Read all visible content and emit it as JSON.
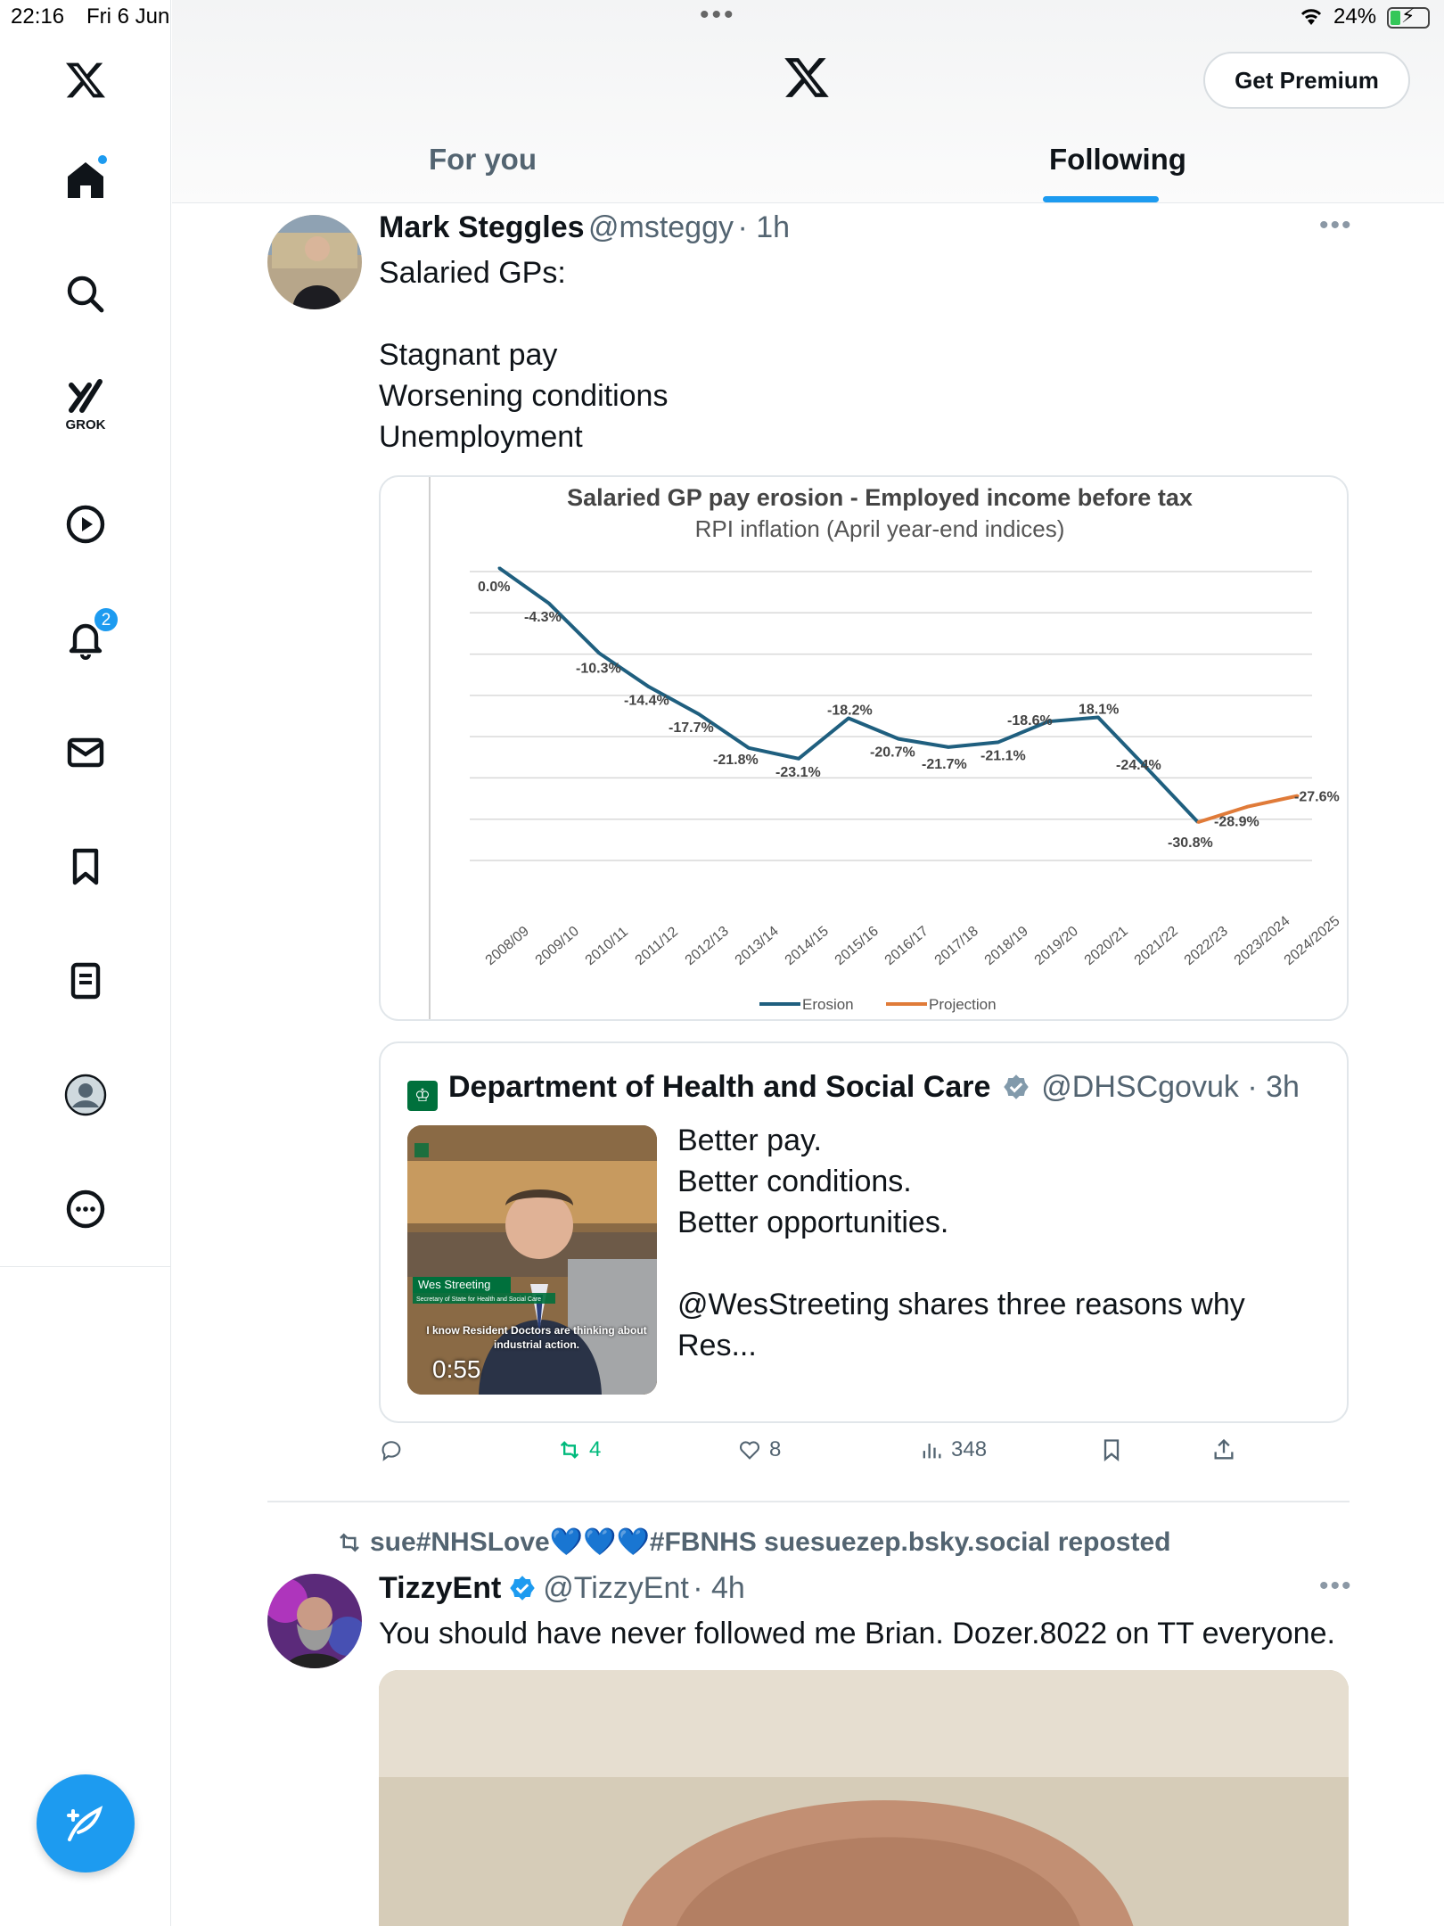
{
  "status": {
    "time": "22:16",
    "date": "Fri 6 Jun",
    "battery": "24%"
  },
  "header": {
    "premium_label": "Get Premium",
    "tabs": [
      {
        "label": "For you"
      },
      {
        "label": "Following"
      }
    ]
  },
  "sidebar": {
    "grok_label": "GROK",
    "notifications_count": "2"
  },
  "tweet1": {
    "name": "Mark Steggles",
    "handle": "@msteggy",
    "time": "· 1h",
    "text": "Salaried GPs:\n\nStagnant pay\nWorsening conditions\nUnemployment",
    "quote": {
      "name": "Department of Health and Social Care",
      "handle": "@DHSCgovuk",
      "time": "· 3h",
      "text": "Better pay.\nBetter conditions.\nBetter opportunities.\n\n@WesStreeting shares three reasons why Res...",
      "video_duration": "0:55",
      "video_caption_name": "Wes Streeting",
      "video_caption_sub": "Secretary of State for Health and Social Care",
      "video_caption_quote": "I know Resident Doctors are thinking about industrial action."
    },
    "stats": {
      "reposts": "4",
      "likes": "8",
      "views": "348"
    }
  },
  "tweet2": {
    "repost_by": "sue#NHSLove💙💙💙#FBNHS suesuezep.bsky.social reposted",
    "name": "TizzyEnt",
    "handle": "@TizzyEnt",
    "time": "· 4h",
    "text": "You should have never followed me Brian. Dozer.8022 on TT everyone."
  },
  "chart_data": {
    "type": "line",
    "title": "Salaried GP pay erosion - Employed income before tax",
    "subtitle": "RPI inflation (April year-end indices)",
    "categories": [
      "2008/09",
      "2009/10",
      "2010/11",
      "2011/12",
      "2012/13",
      "2013/14",
      "2014/15",
      "2015/16",
      "2016/17",
      "2017/18",
      "2018/19",
      "2019/20",
      "2020/21",
      "2021/22",
      "2022/23",
      "2023/2024",
      "2024/2025"
    ],
    "series": [
      {
        "name": "Erosion",
        "color": "#1f5f7f",
        "values": [
          0.0,
          -4.3,
          -10.3,
          -14.4,
          -17.7,
          -21.8,
          -23.1,
          -18.2,
          -20.7,
          -21.7,
          -21.1,
          -18.6,
          -18.1,
          -24.4,
          -30.8,
          null,
          null
        ]
      },
      {
        "name": "Projection",
        "color": "#e07b39",
        "values": [
          null,
          null,
          null,
          null,
          null,
          null,
          null,
          null,
          null,
          null,
          null,
          null,
          null,
          null,
          -30.8,
          -28.9,
          -27.6
        ]
      }
    ],
    "data_labels": [
      "0.0%",
      "-4.3%",
      "-10.3%",
      "-14.4%",
      "-17.7%",
      "-21.8%",
      "-23.1%",
      "-18.2%",
      "-20.7%",
      "-21.7%",
      "-21.1%",
      "-18.6%",
      "18.1%",
      "-24.4%",
      "-30.8%",
      "-28.9%",
      "-27.6%"
    ],
    "ylim": [
      -35,
      0
    ],
    "grid": true,
    "legend": "bottom"
  }
}
